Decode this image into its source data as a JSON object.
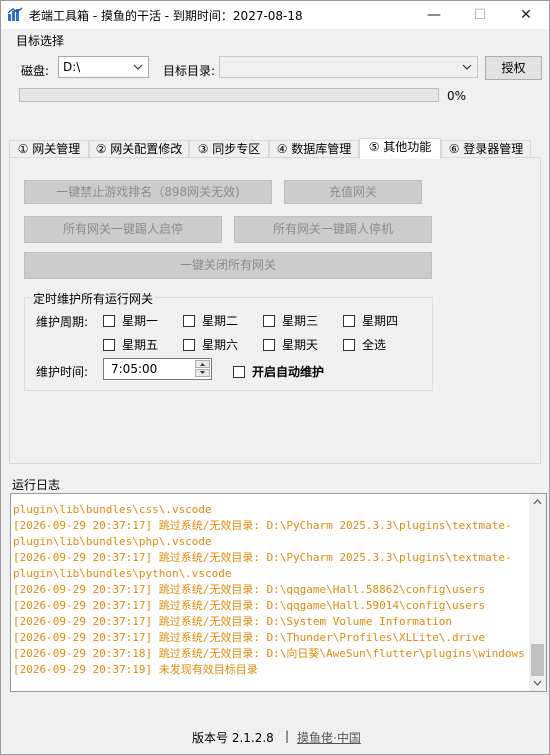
{
  "window": {
    "title": "老端工具箱 - 摸鱼的干活 - 到期时间：2027-08-18",
    "minimize_glyph": "—",
    "maximize_glyph": "☐",
    "close_glyph": "✕"
  },
  "target_select": {
    "group_label": "目标选择",
    "disk_label": "磁盘:",
    "disk_value": "D:\\",
    "dir_label": "目标目录:",
    "dir_value": "",
    "authorize_label": "授权",
    "progress_percent": 0,
    "progress_text": "0%"
  },
  "tabs": [
    {
      "label": "① 网关管理",
      "active": false
    },
    {
      "label": "② 网关配置修改",
      "active": false
    },
    {
      "label": "③ 同步专区",
      "active": false
    },
    {
      "label": "④ 数据库管理",
      "active": false
    },
    {
      "label": "⑤ 其他功能",
      "active": true
    },
    {
      "label": "⑥ 登录器管理",
      "active": false
    }
  ],
  "other_functions": {
    "btn_ban_ranking": "一键禁止游戏排名（898网关无效)",
    "btn_recharge": "充值网关",
    "btn_kick_start": "所有网关一键踢人启停",
    "btn_kick_stop": "所有网关一键踢人停机",
    "btn_close_all": "一键关闭所有网关"
  },
  "maintenance": {
    "legend": "定时维护所有运行网关",
    "period_label": "维护周期:",
    "days": [
      "星期一",
      "星期二",
      "星期三",
      "星期四",
      "星期五",
      "星期六",
      "星期天",
      "全选"
    ],
    "time_label": "维护时间:",
    "time_value": "7:05:00",
    "auto_label": "开启自动维护"
  },
  "log": {
    "label": "运行日志",
    "lines": [
      "plugin\\lib\\bundles\\css\\.vscode",
      "[2026-09-29 20:37:17] 跳过系统/无效目录: D:\\PyCharm 2025.3.3\\plugins\\textmate-",
      "plugin\\lib\\bundles\\php\\.vscode",
      "[2026-09-29 20:37:17] 跳过系统/无效目录: D:\\PyCharm 2025.3.3\\plugins\\textmate-",
      "plugin\\lib\\bundles\\python\\.vscode",
      "[2026-09-29 20:37:17] 跳过系统/无效目录: D:\\qqgame\\Hall.58862\\config\\users",
      "[2026-09-29 20:37:17] 跳过系统/无效目录: D:\\qqgame\\Hall.59014\\config\\users",
      "[2026-09-29 20:37:17] 跳过系统/无效目录: D:\\System Volume Information",
      "[2026-09-29 20:37:17] 跳过系统/无效目录: D:\\Thunder\\Profiles\\XLLite\\.drive",
      "[2026-09-29 20:37:18] 跳过系统/无效目录: D:\\向日葵\\AweSun\\flutter\\plugins\\windows",
      "[2026-09-29 20:37:19] 未发现有效目标目录"
    ]
  },
  "footer": {
    "version": "版本号 2.1.2.8",
    "separator": "|",
    "link": "摸鱼佬·中国"
  },
  "colors": {
    "log_text": "#e08a0b",
    "progress_fill": "#06b025"
  }
}
